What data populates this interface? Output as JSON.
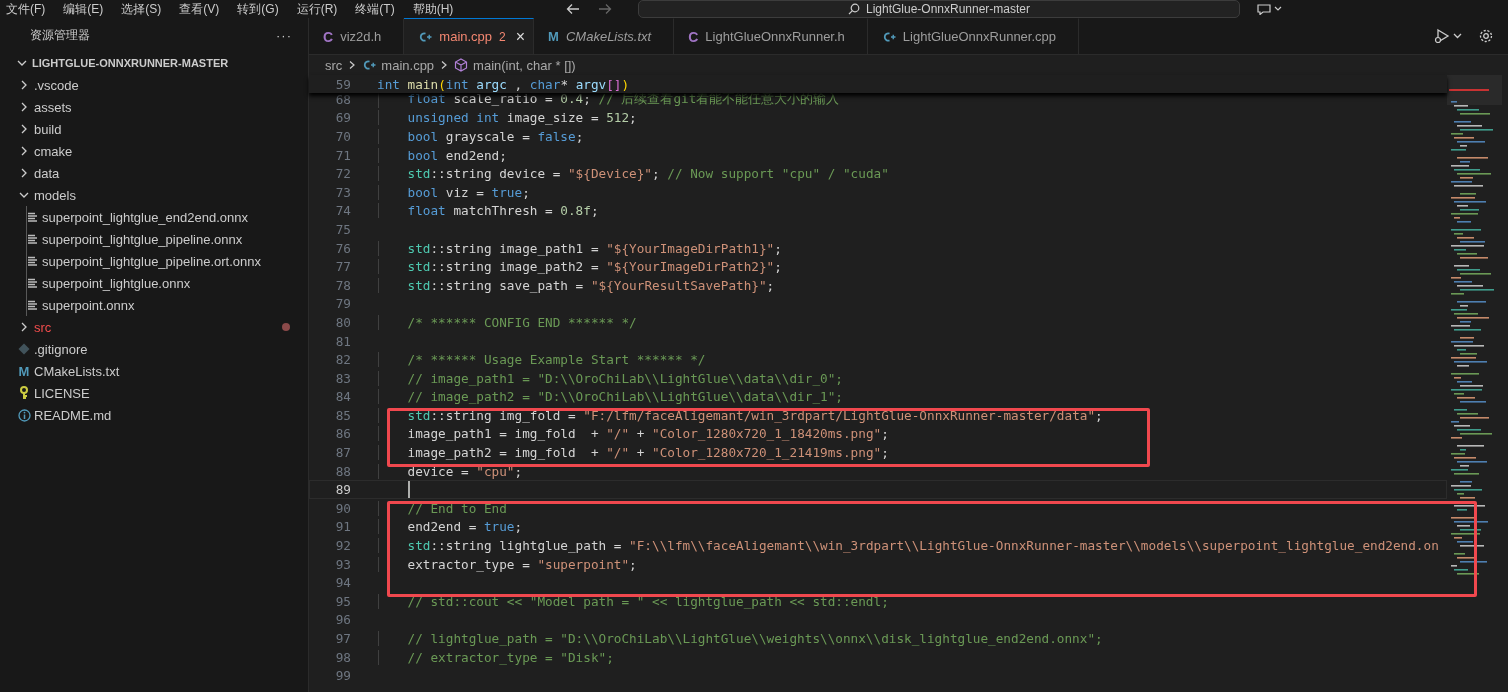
{
  "menu": [
    "文件(F)",
    "编辑(E)",
    "选择(S)",
    "查看(V)",
    "转到(G)",
    "运行(R)",
    "终端(T)",
    "帮助(H)"
  ],
  "command_center": {
    "title": "LightGlue-OnnxRunner-master"
  },
  "explorer": {
    "title": "资源管理器",
    "more": "···",
    "root": {
      "label": "LIGHTGLUE-ONNXRUNNER-MASTER",
      "expanded": true,
      "children": [
        {
          "label": ".vscode",
          "kind": "folder",
          "expanded": false,
          "modified": false
        },
        {
          "label": "assets",
          "kind": "folder",
          "expanded": false,
          "modified": false
        },
        {
          "label": "build",
          "kind": "folder",
          "expanded": false,
          "modified": false
        },
        {
          "label": "cmake",
          "kind": "folder",
          "expanded": false,
          "modified": false
        },
        {
          "label": "data",
          "kind": "folder",
          "expanded": false,
          "modified": false
        },
        {
          "label": "models",
          "kind": "folder",
          "expanded": true,
          "modified": false,
          "children": [
            {
              "label": "superpoint_lightglue_end2end.onnx",
              "kind": "binary",
              "modified": false
            },
            {
              "label": "superpoint_lightglue_pipeline.onnx",
              "kind": "binary",
              "modified": false
            },
            {
              "label": "superpoint_lightglue_pipeline.ort.onnx",
              "kind": "binary",
              "modified": false
            },
            {
              "label": "superpoint_lightglue.onnx",
              "kind": "binary",
              "modified": false
            },
            {
              "label": "superpoint.onnx",
              "kind": "binary",
              "modified": false
            }
          ]
        },
        {
          "label": "src",
          "kind": "folder",
          "expanded": false,
          "modified": true
        },
        {
          "label": ".gitignore",
          "kind": "git",
          "modified": false
        },
        {
          "label": "CMakeLists.txt",
          "kind": "cmake",
          "icon": "M",
          "modified": false
        },
        {
          "label": "LICENSE",
          "kind": "license",
          "modified": false
        },
        {
          "label": "README.md",
          "kind": "info",
          "modified": false
        }
      ]
    }
  },
  "tabs": [
    {
      "label": "viz2d.h",
      "kind": "c",
      "icon": "C",
      "selected": false,
      "preview": false
    },
    {
      "label": "main.cpp",
      "kind": "cpp",
      "selected": true,
      "preview": false,
      "badge": "2",
      "close": "×"
    },
    {
      "label": "CMakeLists.txt",
      "kind": "cmake",
      "icon": "M",
      "selected": false,
      "preview": true
    },
    {
      "label": "LightGlueOnnxRunner.h",
      "kind": "c",
      "icon": "C",
      "selected": false,
      "preview": false
    },
    {
      "label": "LightGlueOnnxRunner.cpp",
      "kind": "cpp",
      "selected": false,
      "preview": false
    }
  ],
  "breadcrumb": {
    "folder": "src",
    "file": "main.cpp",
    "symbol": "main(int, char * [])"
  },
  "editor": {
    "sticky_line": {
      "no": "59",
      "tokens": [
        {
          "kind": "k",
          "text": "int"
        },
        {
          "kind": "f",
          "text": " main"
        },
        {
          "kind": "b1",
          "text": "("
        },
        {
          "kind": "k",
          "text": "int"
        },
        {
          "kind": "v",
          "text": " argc"
        },
        {
          "kind": "p",
          "text": " , "
        },
        {
          "kind": "k",
          "text": "char"
        },
        {
          "kind": "p",
          "text": "* "
        },
        {
          "kind": "v",
          "text": "argv"
        },
        {
          "kind": "b2",
          "text": "[]"
        },
        {
          "kind": "b1",
          "text": ")"
        }
      ]
    },
    "lines": [
      {
        "no": "68",
        "current": false,
        "boxed": false,
        "tokens": [
          {
            "kind": "k",
            "text": "    float"
          },
          {
            "kind": "p",
            "text": " scale_ratio = "
          },
          {
            "kind": "n",
            "text": "0.4"
          },
          {
            "kind": "p",
            "text": "; "
          },
          {
            "kind": "c",
            "text": "// 后续查看git看能不能任意大小的输入"
          }
        ]
      },
      {
        "no": "69",
        "current": false,
        "boxed": false,
        "tokens": [
          {
            "kind": "k",
            "text": "    unsigned int"
          },
          {
            "kind": "p",
            "text": " image_size = "
          },
          {
            "kind": "n",
            "text": "512"
          },
          {
            "kind": "p",
            "text": ";"
          }
        ]
      },
      {
        "no": "70",
        "current": false,
        "boxed": false,
        "tokens": [
          {
            "kind": "k",
            "text": "    bool"
          },
          {
            "kind": "p",
            "text": " grayscale = "
          },
          {
            "kind": "k",
            "text": "false"
          },
          {
            "kind": "p",
            "text": ";"
          }
        ]
      },
      {
        "no": "71",
        "current": false,
        "boxed": false,
        "tokens": [
          {
            "kind": "k",
            "text": "    bool"
          },
          {
            "kind": "p",
            "text": " end2end;"
          }
        ]
      },
      {
        "no": "72",
        "current": false,
        "boxed": false,
        "tokens": [
          {
            "kind": "t",
            "text": "    std"
          },
          {
            "kind": "p",
            "text": "::string device = "
          },
          {
            "kind": "s",
            "text": "\"${Device}\""
          },
          {
            "kind": "p",
            "text": "; "
          },
          {
            "kind": "c",
            "text": "// Now support \"cpu\" / \"cuda\""
          }
        ]
      },
      {
        "no": "73",
        "current": false,
        "boxed": false,
        "tokens": [
          {
            "kind": "k",
            "text": "    bool"
          },
          {
            "kind": "p",
            "text": " viz = "
          },
          {
            "kind": "k",
            "text": "true"
          },
          {
            "kind": "p",
            "text": ";"
          }
        ]
      },
      {
        "no": "74",
        "current": false,
        "boxed": false,
        "tokens": [
          {
            "kind": "k",
            "text": "    float"
          },
          {
            "kind": "p",
            "text": " matchThresh = "
          },
          {
            "kind": "n",
            "text": "0.8f"
          },
          {
            "kind": "p",
            "text": ";"
          }
        ]
      },
      {
        "no": "75",
        "current": false,
        "boxed": false
      },
      {
        "no": "76",
        "current": false,
        "boxed": false,
        "tokens": [
          {
            "kind": "t",
            "text": "    std"
          },
          {
            "kind": "p",
            "text": "::string image_path1 = "
          },
          {
            "kind": "s",
            "text": "\"${YourImageDirPath1}\""
          },
          {
            "kind": "p",
            "text": ";"
          }
        ]
      },
      {
        "no": "77",
        "current": false,
        "boxed": false,
        "tokens": [
          {
            "kind": "t",
            "text": "    std"
          },
          {
            "kind": "p",
            "text": "::string image_path2 = "
          },
          {
            "kind": "s",
            "text": "\"${YourImageDirPath2}\""
          },
          {
            "kind": "p",
            "text": ";"
          }
        ]
      },
      {
        "no": "78",
        "current": false,
        "boxed": false,
        "tokens": [
          {
            "kind": "t",
            "text": "    std"
          },
          {
            "kind": "p",
            "text": "::string save_path = "
          },
          {
            "kind": "s",
            "text": "\"${YourResultSavePath}\""
          },
          {
            "kind": "p",
            "text": ";"
          }
        ]
      },
      {
        "no": "79",
        "current": false,
        "boxed": false
      },
      {
        "no": "80",
        "current": false,
        "boxed": false,
        "tokens": [
          {
            "kind": "c",
            "text": "    /* ****** CONFIG END ****** */"
          }
        ]
      },
      {
        "no": "81",
        "current": false,
        "boxed": false
      },
      {
        "no": "82",
        "current": false,
        "boxed": false,
        "tokens": [
          {
            "kind": "c",
            "text": "    /* ****** Usage Example Start ****** */"
          }
        ]
      },
      {
        "no": "83",
        "current": false,
        "boxed": false,
        "tokens": [
          {
            "kind": "c",
            "text": "    // image_path1 = \"D:\\\\OroChiLab\\\\LightGlue\\\\data\\\\dir_0\";"
          }
        ]
      },
      {
        "no": "84",
        "current": false,
        "boxed": false,
        "tokens": [
          {
            "kind": "c",
            "text": "    // image_path2 = \"D:\\\\OroChiLab\\\\LightGlue\\\\data\\\\dir_1\";"
          }
        ]
      },
      {
        "no": "85",
        "current": false,
        "boxed": true,
        "tokens": [
          {
            "kind": "t",
            "text": "    std"
          },
          {
            "kind": "p",
            "text": "::string img_fold = "
          },
          {
            "kind": "s",
            "text": "\"F:/lfm/faceAligemant/win_3rdpart/LightGlue-OnnxRunner-master/data\""
          },
          {
            "kind": "p",
            "text": ";"
          }
        ]
      },
      {
        "no": "86",
        "current": false,
        "boxed": true,
        "tokens": [
          {
            "kind": "p",
            "text": "    image_path1 = img_fold  + "
          },
          {
            "kind": "s",
            "text": "\"/\""
          },
          {
            "kind": "p",
            "text": " + "
          },
          {
            "kind": "s",
            "text": "\"Color_1280x720_1_18420ms.png\""
          },
          {
            "kind": "p",
            "text": ";"
          }
        ]
      },
      {
        "no": "87",
        "current": false,
        "boxed": true,
        "tokens": [
          {
            "kind": "p",
            "text": "    image_path2 = img_fold  + "
          },
          {
            "kind": "s",
            "text": "\"/\""
          },
          {
            "kind": "p",
            "text": " + "
          },
          {
            "kind": "s",
            "text": "\"Color_1280x720_1_21419ms.png\""
          },
          {
            "kind": "p",
            "text": ";"
          }
        ]
      },
      {
        "no": "88",
        "current": false,
        "boxed": false,
        "tokens": [
          {
            "kind": "p",
            "text": "    device = "
          },
          {
            "kind": "s",
            "text": "\"cpu\""
          },
          {
            "kind": "p",
            "text": ";"
          }
        ]
      },
      {
        "no": "89",
        "current": true,
        "boxed": false
      },
      {
        "no": "90",
        "current": false,
        "boxed": true,
        "tokens": [
          {
            "kind": "c",
            "text": "    // End to End"
          }
        ]
      },
      {
        "no": "91",
        "current": false,
        "boxed": true,
        "tokens": [
          {
            "kind": "p",
            "text": "    end2end = "
          },
          {
            "kind": "k",
            "text": "true"
          },
          {
            "kind": "p",
            "text": ";"
          }
        ]
      },
      {
        "no": "92",
        "current": false,
        "boxed": true,
        "tokens": [
          {
            "kind": "t",
            "text": "    std"
          },
          {
            "kind": "p",
            "text": "::string lightglue_path = "
          },
          {
            "kind": "s",
            "text": "\"F:\\\\lfm\\\\faceAligemant\\\\win_3rdpart\\\\LightGlue-OnnxRunner-master\\\\models\\\\superpoint_lightglue_end2end.on"
          }
        ]
      },
      {
        "no": "93",
        "current": false,
        "boxed": true,
        "tokens": [
          {
            "kind": "p",
            "text": "    extractor_type = "
          },
          {
            "kind": "s",
            "text": "\"superpoint\""
          },
          {
            "kind": "p",
            "text": ";"
          }
        ]
      },
      {
        "no": "94",
        "current": false,
        "boxed": true
      },
      {
        "no": "95",
        "current": false,
        "boxed": false,
        "tokens": [
          {
            "kind": "c",
            "text": "    // std::cout << \"Model path = \" << lightglue_path << std::endl;"
          }
        ]
      },
      {
        "no": "96",
        "current": false,
        "boxed": false
      },
      {
        "no": "97",
        "current": false,
        "boxed": false,
        "tokens": [
          {
            "kind": "c",
            "text": "    // lightglue_path = \"D:\\\\OroChiLab\\\\LightGlue\\\\weights\\\\onnx\\\\disk_lightglue_end2end.onnx\";"
          }
        ]
      },
      {
        "no": "98",
        "current": false,
        "boxed": false,
        "tokens": [
          {
            "kind": "c",
            "text": "    // extractor_type = \"Disk\";"
          }
        ]
      },
      {
        "no": "99",
        "current": false,
        "boxed": false
      }
    ]
  }
}
